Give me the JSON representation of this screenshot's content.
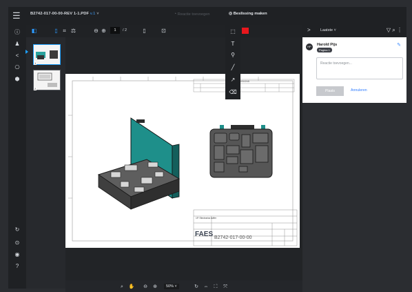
{
  "topbar": {
    "filename": "B2742-017-00-00-REV 1-1.PDF",
    "version": "v.1",
    "chevron": "˅",
    "comment_muted": "Reactie toevoegen",
    "make_decision": "Beslissing maken"
  },
  "toolbar": {
    "page_current": "1",
    "page_total": "/ 2"
  },
  "thumbnails": [
    {
      "num": "1"
    },
    {
      "num": "2"
    }
  ],
  "drawing": {
    "revisions_title": "REVISIONS",
    "product": "19\" Electronics koffer",
    "title_block": {
      "logo": "FAES",
      "drawing_number": "B2742-017-00-00"
    }
  },
  "zoom": {
    "value": "50% ˅"
  },
  "right_panel": {
    "sort_label": "Laatste ˅",
    "comment": {
      "author": "Harold Pijs",
      "badge": "Pagina 1",
      "placeholder": "Reactie toevoegen...",
      "post_label": "Plaats",
      "cancel_label": "Annuleren"
    }
  },
  "colors": {
    "accent": "#2d9bff",
    "annotation_red": "#e8171d",
    "teal": "#1f8b86",
    "dark": "#1f2124"
  }
}
